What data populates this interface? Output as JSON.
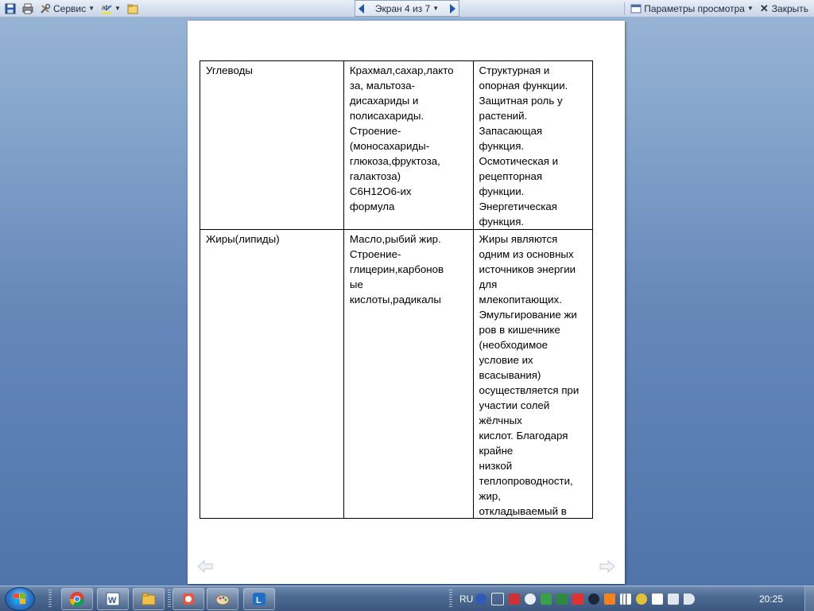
{
  "toolbar": {
    "service_label": "Сервис",
    "screen_label": "Экран 4 из 7",
    "view_options_label": "Параметры просмотра",
    "close_label": "Закрыть"
  },
  "document": {
    "rows": [
      {
        "name": "Углеводы",
        "examples": "Крахмал,сахар,лакто\nза, мальтоза-\nдисахариды и\nполисахариды.\nСтроение-\n(моносахариды-\nглюкоза,фруктоза,\nгалактоза)\nС6Н12О6-их\nформула",
        "functions": "Структурная и\nопорная функции.\nЗащитная роль у\nрастений.\nЗапасающая\n функция.\nОсмотическая и\nрецепторная\nфункции.\nЭнергетическая\nфункция."
      },
      {
        "name": "Жиры(липиды)",
        "examples": "Масло,рыбий жир.\nСтроение-\nглицерин,карбонов\nые\nкислоты,радикалы",
        "functions": "Жиры являются\nодним из основных\nисточников энергии\nдля\nмлекопитающих.\nЭмульгирование жи\nров в кишечнике\n(необходимое\nусловие их\nвсасывания)\nосуществляется при\nучастии солей\nжёлчных\nкислот. Благодаря\nкрайне\nнизкой\nтеплопроводности,\nжир,\nоткладываемый в"
      }
    ]
  },
  "taskbar": {
    "language": "RU",
    "time": "20:25"
  },
  "colors": {
    "desktop": "#6688b9",
    "toolbar": "#d7e1ef",
    "accent": "#2456a6",
    "taskbar": "#4d6a92"
  }
}
